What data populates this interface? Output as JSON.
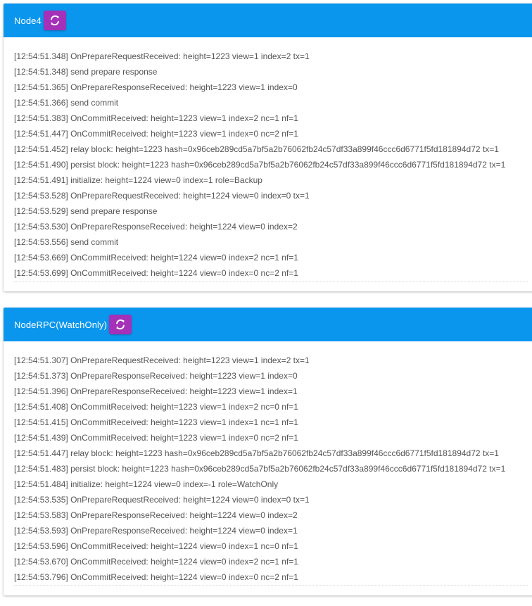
{
  "panels": [
    {
      "title": "Node4",
      "refresh_icon": "refresh-icon",
      "lines": [
        "[12:54:51.348] OnPrepareRequestReceived: height=1223 view=1 index=2 tx=1",
        "[12:54:51.348] send prepare response",
        "[12:54:51.365] OnPrepareResponseReceived: height=1223 view=1 index=0",
        "[12:54:51.366] send commit",
        "[12:54:51.383] OnCommitReceived: height=1223 view=1 index=2 nc=1 nf=1",
        "[12:54:51.447] OnCommitReceived: height=1223 view=1 index=0 nc=2 nf=1",
        "[12:54:51.452] relay block: height=1223 hash=0x96ceb289cd5a7bf5a2b76062fb24c57df33a899f46ccc6d6771f5fd181894d72 tx=1",
        "[12:54:51.490] persist block: height=1223 hash=0x96ceb289cd5a7bf5a2b76062fb24c57df33a899f46ccc6d6771f5fd181894d72 tx=1",
        "[12:54:51.491] initialize: height=1224 view=0 index=1 role=Backup",
        "[12:54:53.528] OnPrepareRequestReceived: height=1224 view=0 index=0 tx=1",
        "[12:54:53.529] send prepare response",
        "[12:54:53.530] OnPrepareResponseReceived: height=1224 view=0 index=2",
        "[12:54:53.556] send commit",
        "[12:54:53.669] OnCommitReceived: height=1224 view=0 index=2 nc=1 nf=1",
        "[12:54:53.699] OnCommitReceived: height=1224 view=0 index=0 nc=2 nf=1"
      ]
    },
    {
      "title": "NodeRPC(WatchOnly)",
      "refresh_icon": "refresh-icon",
      "lines": [
        "[12:54:51.307] OnPrepareRequestReceived: height=1223 view=1 index=2 tx=1",
        "[12:54:51.373] OnPrepareResponseReceived: height=1223 view=1 index=0",
        "[12:54:51.396] OnPrepareResponseReceived: height=1223 view=1 index=1",
        "[12:54:51.408] OnCommitReceived: height=1223 view=1 index=2 nc=0 nf=1",
        "[12:54:51.415] OnCommitReceived: height=1223 view=1 index=1 nc=1 nf=1",
        "[12:54:51.439] OnCommitReceived: height=1223 view=1 index=0 nc=2 nf=1",
        "[12:54:51.447] relay block: height=1223 hash=0x96ceb289cd5a7bf5a2b76062fb24c57df33a899f46ccc6d6771f5fd181894d72 tx=1",
        "[12:54:51.483] persist block: height=1223 hash=0x96ceb289cd5a7bf5a2b76062fb24c57df33a899f46ccc6d6771f5fd181894d72 tx=1",
        "[12:54:51.484] initialize: height=1224 view=0 index=-1 role=WatchOnly",
        "[12:54:53.535] OnPrepareRequestReceived: height=1224 view=0 index=0 tx=1",
        "[12:54:53.583] OnPrepareResponseReceived: height=1224 view=0 index=2",
        "[12:54:53.593] OnPrepareResponseReceived: height=1224 view=0 index=1",
        "[12:54:53.596] OnCommitReceived: height=1224 view=0 index=1 nc=0 nf=1",
        "[12:54:53.670] OnCommitReceived: height=1224 view=0 index=2 nc=1 nf=1",
        "[12:54:53.796] OnCommitReceived: height=1224 view=0 index=0 nc=2 nf=1"
      ]
    }
  ],
  "colors": {
    "header_bg": "#0b96ee",
    "button_bg": "#a531b9",
    "log_text": "#555555"
  }
}
